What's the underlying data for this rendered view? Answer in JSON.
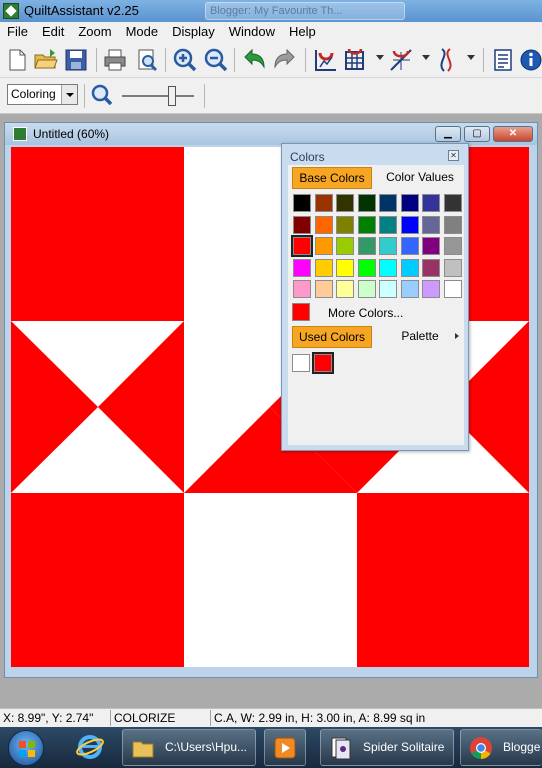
{
  "app": {
    "title": "QuiltAssistant v2.25",
    "background_tab": "Blogger: My Favourite Th..."
  },
  "menu": [
    "File",
    "Edit",
    "Zoom",
    "Mode",
    "Display",
    "Window",
    "Help"
  ],
  "toolbar": {
    "icons": [
      "new-file-icon",
      "open-folder-icon",
      "save-icon",
      "print-icon",
      "print-preview-icon",
      "zoom-in-icon",
      "zoom-out-icon",
      "undo-icon",
      "redo-icon",
      "magnet-grid-icon",
      "grid-icon",
      "diagonal-tool-icon",
      "curve-tool-icon",
      "document-list-icon",
      "info-icon"
    ]
  },
  "toolbar2": {
    "mode_value": "Coloring",
    "zoom_slider_fraction": 0.72
  },
  "document": {
    "title": "Untitled (60%)"
  },
  "colors_panel": {
    "title": "Colors",
    "tab_base": "Base Colors",
    "tab_values": "Color Values",
    "grid": [
      [
        "#000000",
        "#993300",
        "#333300",
        "#003300",
        "#003366",
        "#000080",
        "#333399",
        "#333333"
      ],
      [
        "#800000",
        "#ff6600",
        "#808000",
        "#008000",
        "#008080",
        "#0000ff",
        "#666699",
        "#808080"
      ],
      [
        "#ff0000",
        "#ff9900",
        "#99cc00",
        "#339966",
        "#33cccc",
        "#3366ff",
        "#800080",
        "#969696"
      ],
      [
        "#ff00ff",
        "#ffcc00",
        "#ffff00",
        "#00ff00",
        "#00ffff",
        "#00ccff",
        "#993366",
        "#c0c0c0"
      ],
      [
        "#ff99cc",
        "#ffcc99",
        "#ffff99",
        "#ccffcc",
        "#ccffff",
        "#99ccff",
        "#cc99ff",
        "#ffffff"
      ]
    ],
    "selected_color": "#ff0000",
    "more_colors_label": "More Colors...",
    "tab_used": "Used Colors",
    "tab_palette": "Palette",
    "used_colors": [
      "#ffffff",
      "#ff0000"
    ]
  },
  "quilt": {
    "primary_color": "#ff0000",
    "background_color": "#ffffff"
  },
  "status": {
    "coords": "X: 8.99\", Y: 2.74\"",
    "mode": "COLORIZE",
    "info": "C.A, W: 2.99 in, H: 3.00 in, A: 8.99 sq in"
  },
  "taskbar": {
    "explorer_label": "C:\\Users\\Hpu...",
    "solitaire_label": "Spider Solitaire",
    "chrome_label": "Blogge"
  }
}
